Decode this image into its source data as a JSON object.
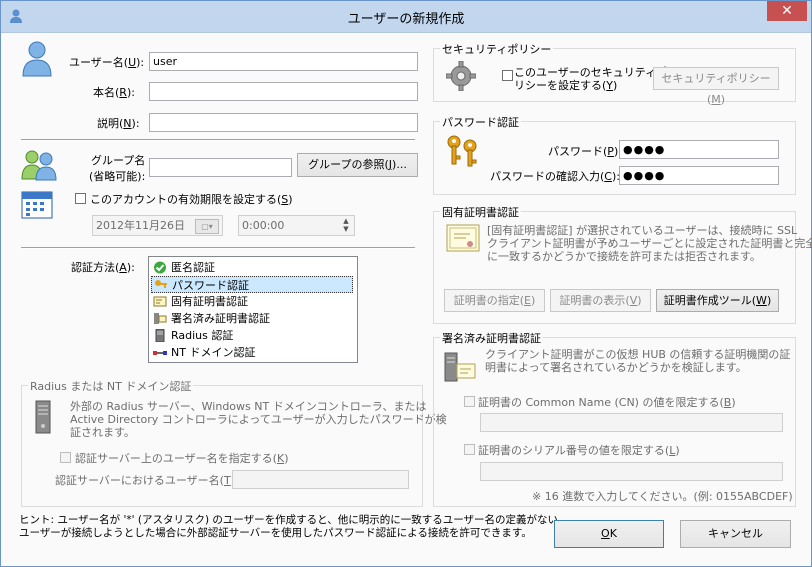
{
  "window": {
    "title": "ユーザーの新規作成",
    "close_label": "✕"
  },
  "user": {
    "username_label": "ユーザー名(",
    "username_key": "U",
    "username_value": "user",
    "realname_label": "本名(",
    "realname_key": "R",
    "realname_value": "",
    "desc_label": "説明(",
    "desc_key": "N",
    "desc_value": ""
  },
  "group": {
    "label_line1": "グループ名",
    "label_line2": "(省略可能):",
    "value": "",
    "browse_label": "グループの参照(",
    "browse_key": "J",
    "browse_suffix": ")..."
  },
  "expiry": {
    "checkbox_label": "このアカウントの有効期限を設定する(",
    "checkbox_key": "S",
    "date_value": "2012年11月26日",
    "time_value": "0:00:00"
  },
  "auth": {
    "label": "認証方法(",
    "label_key": "A",
    "items": [
      {
        "label": "匿名認証",
        "icon": "check-icon"
      },
      {
        "label": "パスワード認証",
        "icon": "keys-icon",
        "selected": true
      },
      {
        "label": "固有証明書認証",
        "icon": "certificate-icon"
      },
      {
        "label": "署名済み証明書認証",
        "icon": "signed-cert-icon"
      },
      {
        "label": "Radius 認証",
        "icon": "server-icon"
      },
      {
        "label": "NT ドメイン認証",
        "icon": "network-icon"
      }
    ]
  },
  "radius": {
    "group_title": "Radius または NT ドメイン認証",
    "desc_line1": "外部の Radius サーバー、Windows NT ドメインコントローラ、または",
    "desc_line2": "Active Directory コントローラによってユーザーが入力したパスワードが検",
    "desc_line3": "証されます。",
    "checkbox_label": "認証サーバー上のユーザー名を指定する(",
    "checkbox_key": "K",
    "server_user_label": "認証サーバーにおけるユーザー名(",
    "server_user_key": "T",
    "server_user_value": ""
  },
  "security": {
    "group_title": "セキュリティポリシー",
    "checkbox_line1": "このユーザーのセキュリティポ",
    "checkbox_line2": "リシーを設定する(",
    "checkbox_key": "Y",
    "button_label": "セキュリティポリシー(",
    "button_key": "M"
  },
  "password": {
    "group_title": "パスワード認証",
    "pw_label": "パスワード(",
    "pw_key": "P",
    "pw_value": "●●●●",
    "confirm_label": "パスワードの確認入力(",
    "confirm_key": "C",
    "confirm_value": "●●●●"
  },
  "cert": {
    "group_title": "固有証明書認証",
    "desc_line1": "[固有証明書認証] が選択されているユーザーは、接続時に SSL",
    "desc_line2": "クライアント証明書が予めユーザーごとに設定された証明書と完全",
    "desc_line3": "に一致するかどうかで接続を許可または拒否されます。",
    "specify_label": "証明書の指定(",
    "specify_key": "E",
    "view_label": "証明書の表示(",
    "view_key": "V",
    "create_label": "証明書作成ツール(",
    "create_key": "W"
  },
  "signed": {
    "group_title": "署名済み証明書認証",
    "desc_line1": "クライアント証明書がこの仮想 HUB の信頼する証明機関の証",
    "desc_line2": "明書によって署名されているかどうかを検証します。",
    "cn_label": "証明書の Common Name (CN) の値を限定する(",
    "cn_key": "B",
    "cn_value": "",
    "serial_label": "証明書のシリアル番号の値を限定する(",
    "serial_key": "L",
    "serial_value": "",
    "hex_note": "※ 16 進数で入力してください。(例: 0155ABCDEF)"
  },
  "hint": {
    "line1": "ヒント: ユーザー名が '*' (アスタリスク) のユーザーを作成すると、他に明示的に一致するユーザー名の定義がない",
    "line2": "ユーザーが接続しようとした場合に外部認証サーバーを使用したパスワード認証による接続を許可できます。"
  },
  "footer": {
    "ok_key": "O",
    "ok_suffix": "K",
    "cancel_label": "キャンセル"
  }
}
